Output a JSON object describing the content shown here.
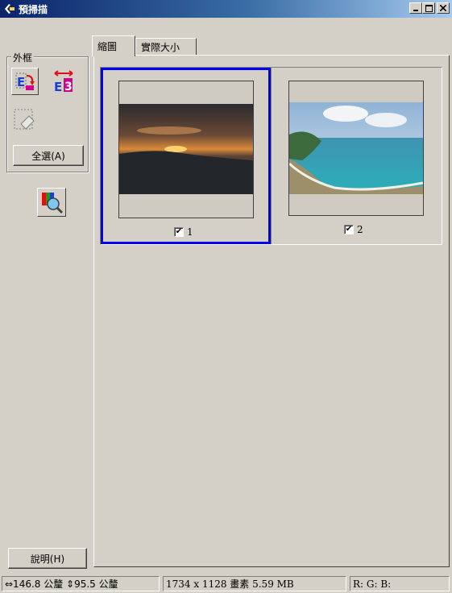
{
  "window": {
    "title": "預掃描",
    "minimize_label": "_",
    "maximize_label": "□",
    "close_label": "×"
  },
  "tabs": [
    {
      "label": "縮圖",
      "active": true
    },
    {
      "label": "實際大小",
      "active": false
    }
  ],
  "frame_group": {
    "label": "外框",
    "select_all_label": "全選(A)"
  },
  "help_button_label": "說明(H)",
  "thumbnails": [
    {
      "number": "1",
      "checked": true,
      "selected": true,
      "icon": "sunset-photo"
    },
    {
      "number": "2",
      "checked": true,
      "selected": false,
      "icon": "beach-photo"
    }
  ],
  "checkmark": "✔",
  "statusbar": {
    "size": "⇔146.8 公釐 ⇕95.5 公釐",
    "pixels": "1734 x 1128 畫素 5.59 MB",
    "rgb": "R: G: B:"
  },
  "colors": {
    "titlebar_start": "#0a246a",
    "selection": "#0000ff",
    "face": "#d4d0c8"
  }
}
